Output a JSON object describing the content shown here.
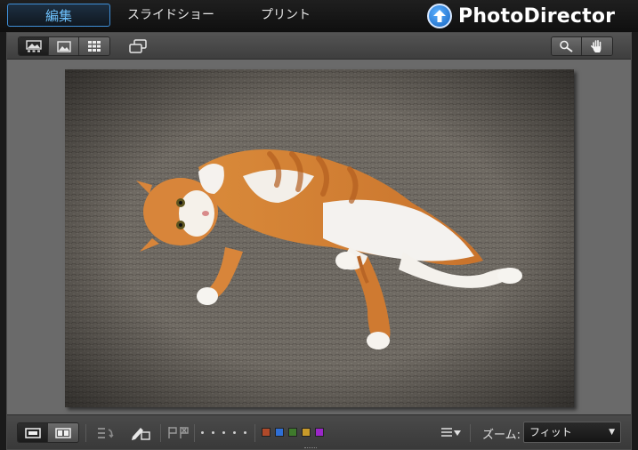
{
  "tabs": [
    {
      "label": "編集",
      "active": true
    },
    {
      "label": "スライドショー",
      "active": false
    },
    {
      "label": "プリント",
      "active": false
    }
  ],
  "app": {
    "name": "PhotoDirector",
    "logo_icon": "up-arrow-badge-icon"
  },
  "top_toolbar": {
    "view_modes": [
      {
        "name": "single-photo-view-icon",
        "active": true
      },
      {
        "name": "thumbnail-view-icon",
        "active": false
      },
      {
        "name": "grid-view-icon",
        "active": false
      }
    ],
    "extra": "second-monitor-icon",
    "tools": [
      "zoom-magnifier-icon",
      "hand-pan-icon"
    ]
  },
  "bottom_toolbar": {
    "compare_modes": [
      {
        "name": "single-compare-icon",
        "active": true
      },
      {
        "name": "side-by-side-icon",
        "active": false
      }
    ],
    "color_labels": [
      "#b04a2a",
      "#2f6fd6",
      "#3f7a2c",
      "#c89a2a",
      "#9b27c9"
    ],
    "rating_dots": 5,
    "zoom_label": "ズーム:",
    "zoom_value": "フィット"
  },
  "colors": {
    "accent": "#3f8fd8",
    "panel_bg": "#6a6a6a"
  }
}
